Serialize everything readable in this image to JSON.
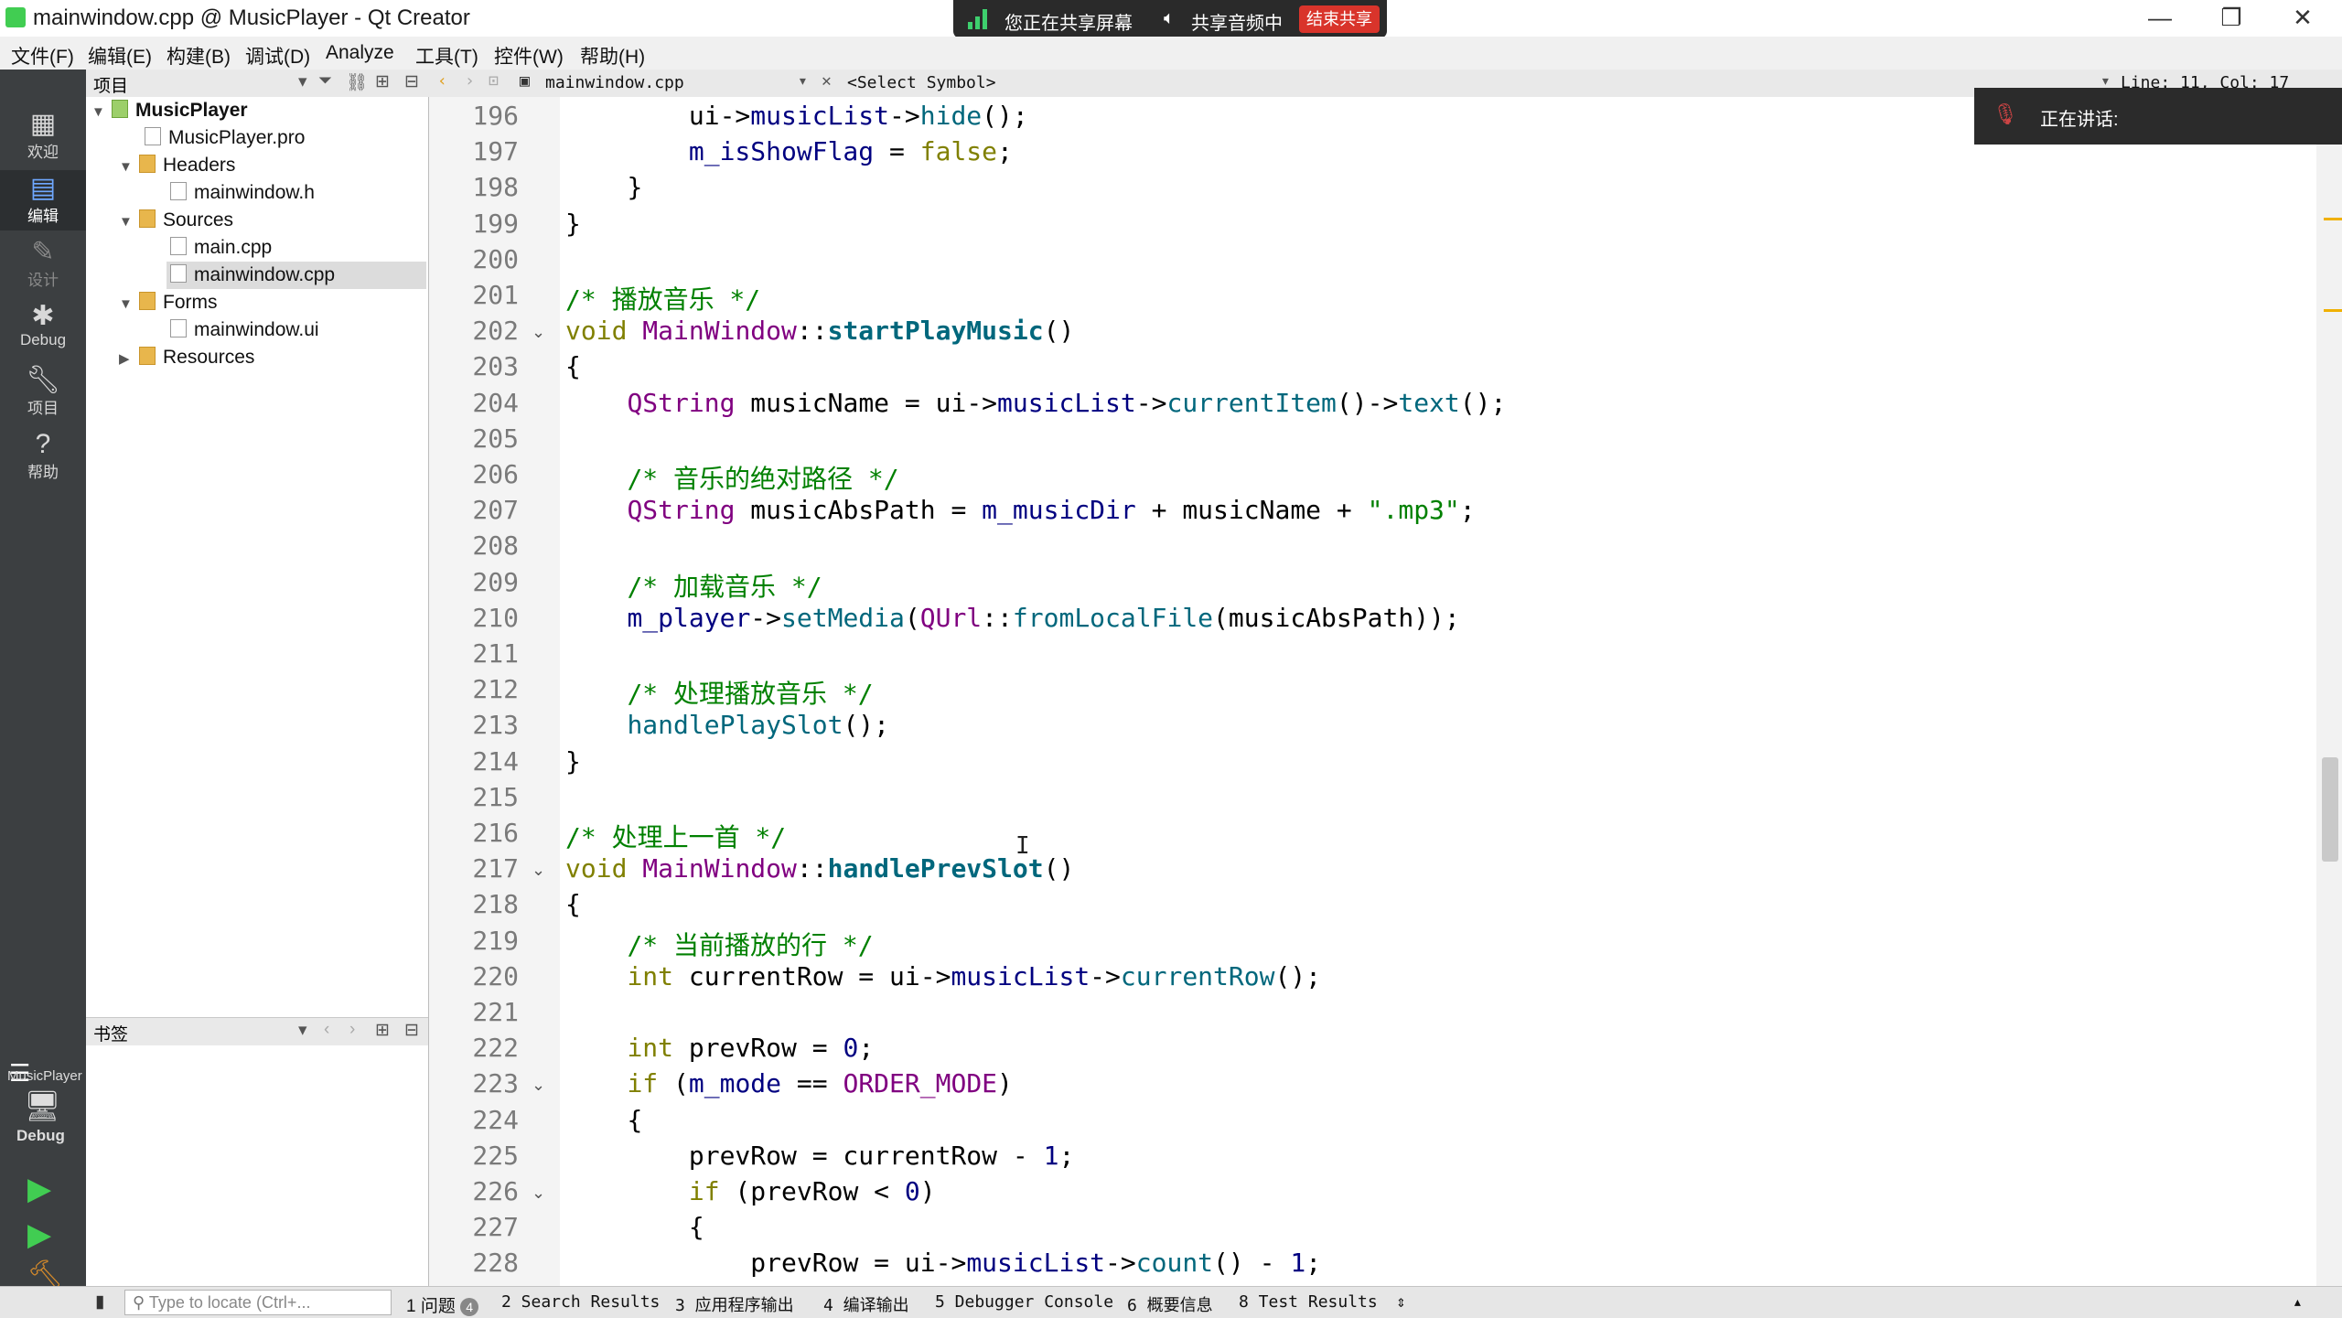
{
  "window": {
    "title": "mainwindow.cpp @ MusicPlayer - Qt Creator",
    "minimize": "—",
    "restore": "❐",
    "close": "✕"
  },
  "share": {
    "status": "您正在共享屏幕",
    "audio": "共享音频中",
    "stop": "结束共享"
  },
  "speaking": {
    "label": "正在讲话:"
  },
  "menu": [
    "文件(F)",
    "编辑(E)",
    "构建(B)",
    "调试(D)",
    "Analyze",
    "工具(T)",
    "控件(W)",
    "帮助(H)"
  ],
  "modes": [
    {
      "label": "欢迎",
      "icon": "grid-icon"
    },
    {
      "label": "编辑",
      "icon": "edit-icon"
    },
    {
      "label": "设计",
      "icon": "pencil-icon"
    },
    {
      "label": "Debug",
      "icon": "bug-icon"
    },
    {
      "label": "项目",
      "icon": "wrench-icon"
    },
    {
      "label": "帮助",
      "icon": "help-icon"
    }
  ],
  "kit": {
    "label": "MusicPlayer",
    "mode": "Debug"
  },
  "project_pane": {
    "header": "项目",
    "tree": [
      {
        "label": "MusicPlayer"
      },
      {
        "label": "MusicPlayer.pro"
      },
      {
        "label": "Headers"
      },
      {
        "label": "mainwindow.h"
      },
      {
        "label": "Sources"
      },
      {
        "label": "main.cpp"
      },
      {
        "label": "mainwindow.cpp"
      },
      {
        "label": "Forms"
      },
      {
        "label": "mainwindow.ui"
      },
      {
        "label": "Resources"
      }
    ]
  },
  "bookmarks": {
    "header": "书签"
  },
  "editor": {
    "file_tab": "mainwindow.cpp",
    "symbol": "<Select Symbol>",
    "position": "Line: 11, Col: 17",
    "line_numbers": [
      "196",
      "197",
      "198",
      "199",
      "200",
      "201",
      "202",
      "203",
      "204",
      "205",
      "206",
      "207",
      "208",
      "209",
      "210",
      "211",
      "212",
      "213",
      "214",
      "215",
      "216",
      "217",
      "218",
      "219",
      "220",
      "221",
      "222",
      "223",
      "224",
      "225",
      "226",
      "227",
      "228"
    ],
    "lines": [
      {
        "indent": "        ",
        "parts": [
          [
            "p",
            "ui->"
          ],
          [
            "c",
            "musicList"
          ],
          [
            "p",
            "->"
          ],
          [
            "fn",
            "hide"
          ],
          [
            "p",
            "();"
          ]
        ]
      },
      {
        "indent": "        ",
        "parts": [
          [
            "c",
            "m_isShowFlag"
          ],
          [
            "p",
            " = "
          ],
          [
            "k",
            "false"
          ],
          [
            "p",
            ";"
          ]
        ]
      },
      {
        "indent": "    ",
        "parts": [
          [
            "p",
            "}"
          ]
        ]
      },
      {
        "indent": "",
        "parts": [
          [
            "p",
            "}"
          ]
        ]
      },
      {
        "indent": "",
        "parts": []
      },
      {
        "indent": "",
        "parts": [
          [
            "s",
            "/* 播放音乐 */"
          ]
        ]
      },
      {
        "indent": "",
        "parts": [
          [
            "k",
            "void"
          ],
          [
            "p",
            " "
          ],
          [
            "cls",
            "MainWindow"
          ],
          [
            "p",
            "::"
          ],
          [
            "fnb",
            "startPlayMusic"
          ],
          [
            "p",
            "()"
          ]
        ]
      },
      {
        "indent": "",
        "parts": [
          [
            "p",
            "{"
          ]
        ]
      },
      {
        "indent": "    ",
        "parts": [
          [
            "cls",
            "QString"
          ],
          [
            "p",
            " musicName = ui->"
          ],
          [
            "c",
            "musicList"
          ],
          [
            "p",
            "->"
          ],
          [
            "fn",
            "currentItem"
          ],
          [
            "p",
            "()->"
          ],
          [
            "fn",
            "text"
          ],
          [
            "p",
            "();"
          ]
        ]
      },
      {
        "indent": "",
        "parts": []
      },
      {
        "indent": "    ",
        "parts": [
          [
            "s",
            "/* 音乐的绝对路径 */"
          ]
        ]
      },
      {
        "indent": "    ",
        "parts": [
          [
            "cls",
            "QString"
          ],
          [
            "p",
            " musicAbsPath = "
          ],
          [
            "c",
            "m_musicDir"
          ],
          [
            "p",
            " + musicName + "
          ],
          [
            "s",
            "\".mp3\""
          ],
          [
            "p",
            ";"
          ]
        ]
      },
      {
        "indent": "",
        "parts": []
      },
      {
        "indent": "    ",
        "parts": [
          [
            "s",
            "/* 加载音乐 */"
          ]
        ]
      },
      {
        "indent": "    ",
        "parts": [
          [
            "c",
            "m_player"
          ],
          [
            "p",
            "->"
          ],
          [
            "fn",
            "setMedia"
          ],
          [
            "p",
            "("
          ],
          [
            "cls",
            "QUrl"
          ],
          [
            "p",
            "::"
          ],
          [
            "fn",
            "fromLocalFile"
          ],
          [
            "p",
            "(musicAbsPath));"
          ]
        ]
      },
      {
        "indent": "",
        "parts": []
      },
      {
        "indent": "    ",
        "parts": [
          [
            "s",
            "/* 处理播放音乐 */"
          ]
        ]
      },
      {
        "indent": "    ",
        "parts": [
          [
            "fn",
            "handlePlaySlot"
          ],
          [
            "p",
            "();"
          ]
        ]
      },
      {
        "indent": "",
        "parts": [
          [
            "p",
            "}"
          ]
        ]
      },
      {
        "indent": "",
        "parts": []
      },
      {
        "indent": "",
        "parts": [
          [
            "s",
            "/* 处理上一首 */"
          ]
        ]
      },
      {
        "indent": "",
        "parts": [
          [
            "k",
            "void"
          ],
          [
            "p",
            " "
          ],
          [
            "cls",
            "MainWindow"
          ],
          [
            "p",
            "::"
          ],
          [
            "fnb",
            "handlePrevSlot"
          ],
          [
            "p",
            "()"
          ]
        ]
      },
      {
        "indent": "",
        "parts": [
          [
            "p",
            "{"
          ]
        ]
      },
      {
        "indent": "    ",
        "parts": [
          [
            "s",
            "/* 当前播放的行 */"
          ]
        ]
      },
      {
        "indent": "    ",
        "parts": [
          [
            "k",
            "int"
          ],
          [
            "p",
            " currentRow = ui->"
          ],
          [
            "c",
            "musicList"
          ],
          [
            "p",
            "->"
          ],
          [
            "fn",
            "currentRow"
          ],
          [
            "p",
            "();"
          ]
        ]
      },
      {
        "indent": "",
        "parts": []
      },
      {
        "indent": "    ",
        "parts": [
          [
            "k",
            "int"
          ],
          [
            "p",
            " prevRow = "
          ],
          [
            "n",
            "0"
          ],
          [
            "p",
            ";"
          ]
        ]
      },
      {
        "indent": "    ",
        "parts": [
          [
            "k",
            "if"
          ],
          [
            "p",
            " ("
          ],
          [
            "c",
            "m_mode"
          ],
          [
            "p",
            " == "
          ],
          [
            "cls",
            "ORDER_MODE"
          ],
          [
            "p",
            ")"
          ]
        ]
      },
      {
        "indent": "    ",
        "parts": [
          [
            "p",
            "{"
          ]
        ]
      },
      {
        "indent": "        ",
        "parts": [
          [
            "p",
            "prevRow = currentRow - "
          ],
          [
            "n",
            "1"
          ],
          [
            "p",
            ";"
          ]
        ]
      },
      {
        "indent": "        ",
        "parts": [
          [
            "k",
            "if"
          ],
          [
            "p",
            " (prevRow < "
          ],
          [
            "n",
            "0"
          ],
          [
            "p",
            ")"
          ]
        ]
      },
      {
        "indent": "        ",
        "parts": [
          [
            "p",
            "{"
          ]
        ]
      },
      {
        "indent": "            ",
        "parts": [
          [
            "p",
            "prevRow = ui->"
          ],
          [
            "c",
            "musicList"
          ],
          [
            "p",
            "->"
          ],
          [
            "fn",
            "count"
          ],
          [
            "p",
            "() - "
          ],
          [
            "n",
            "1"
          ],
          [
            "p",
            ";"
          ]
        ]
      }
    ]
  },
  "statusbar": {
    "locator_placeholder": "Type to locate (Ctrl+...",
    "tabs": [
      "1 问题",
      "2 Search Results",
      "3 应用程序输出",
      "4 编译输出",
      "5 Debugger Console",
      "6 概要信息",
      "8 Test Results"
    ],
    "issue_count": "4"
  }
}
